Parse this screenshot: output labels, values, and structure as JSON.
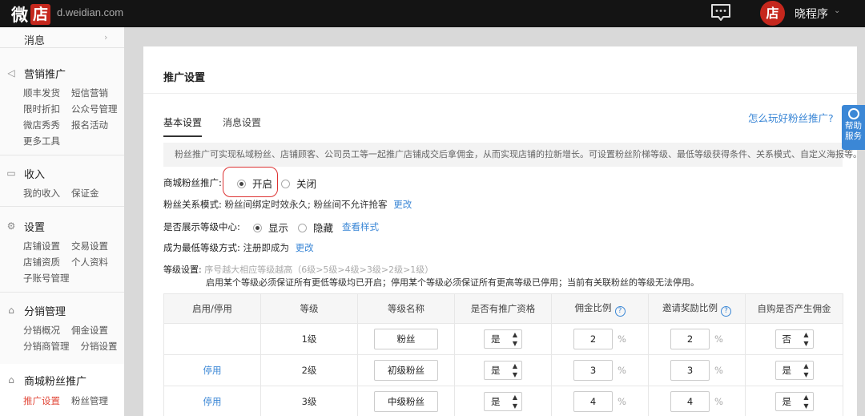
{
  "topbar": {
    "logo_wei": "微",
    "logo_dian": "店",
    "domain": "d.weidian.com",
    "avatar_text": "店",
    "username": "晓程序"
  },
  "sidebar": {
    "top_fragment": "消息",
    "sections": [
      {
        "title": "营销推广",
        "icon": "megaphone-icon",
        "items": [
          [
            "顺丰发货",
            "短信营销"
          ],
          [
            "限时折扣",
            "公众号管理"
          ],
          [
            "微店秀秀",
            "报名活动"
          ],
          [
            "更多工具"
          ]
        ]
      },
      {
        "title": "收入",
        "icon": "wallet-icon",
        "items": [
          [
            "我的收入",
            "保证金"
          ]
        ]
      },
      {
        "title": "设置",
        "icon": "gear-icon",
        "items": [
          [
            "店铺设置",
            "交易设置"
          ],
          [
            "店铺资质",
            "个人资料"
          ],
          [
            "子账号管理"
          ]
        ]
      },
      {
        "title": "分销管理",
        "icon": "bag-icon",
        "items": [
          [
            "分销概况",
            "佣金设置"
          ],
          [
            "分销商管理",
            "分销设置"
          ]
        ]
      }
    ],
    "active_section": {
      "title": "商城粉丝推广",
      "icon": "bag-icon",
      "items": [
        "推广设置",
        "粉丝管理"
      ]
    }
  },
  "main": {
    "title": "推广设置",
    "tabs": [
      "基本设置",
      "消息设置"
    ],
    "help_link": "怎么玩好粉丝推广?",
    "description": "粉丝推广可实现私域粉丝、店铺顾客、公司员工等一起推广店铺成交后拿佣金，从而实现店铺的拉新增长。可设置粉丝阶梯等级、最低等级获得条件、关系模式、自定义海报等。",
    "promo_label": "商城粉丝推广:",
    "promo_on": "开启",
    "promo_off": "关闭",
    "relation_label": "粉丝关系模式:",
    "relation_value": "粉丝间绑定时效永久; 粉丝间不允许抢客",
    "change": "更改",
    "level_center_label": "是否展示等级中心:",
    "show": "显示",
    "hide": "隐藏",
    "view_style": "查看样式",
    "min_level_label": "成为最低等级方式:",
    "min_level_value": "注册即成为",
    "level_setting_label": "等级设置:",
    "level_note": "序号越大相应等级越高（6级>5级>4级>3级>2级>1级）",
    "level_note2": "启用某个等级必须保证所有更低等级均已开启；停用某个等级必须保证所有更高等级已停用；当前有关联粉丝的等级无法停用。"
  },
  "table": {
    "headers": [
      "启用/停用",
      "等级",
      "等级名称",
      "是否有推广资格",
      "佣金比例",
      "邀请奖励比例",
      "自购是否产生佣金"
    ],
    "rows": [
      {
        "action": "",
        "level": "1级",
        "name": "粉丝",
        "eligible": "是",
        "commission": "2",
        "invite": "2",
        "self_buy": "否"
      },
      {
        "action": "停用",
        "level": "2级",
        "name": "初级粉丝",
        "eligible": "是",
        "commission": "3",
        "invite": "3",
        "self_buy": "是"
      },
      {
        "action": "停用",
        "level": "3级",
        "name": "中级粉丝",
        "eligible": "是",
        "commission": "4",
        "invite": "4",
        "self_buy": "是"
      }
    ],
    "percent": "%"
  },
  "help_widget": {
    "line1": "帮助",
    "line2": "服务"
  }
}
